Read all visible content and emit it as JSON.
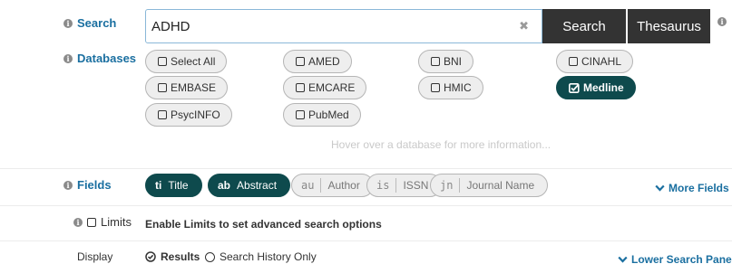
{
  "search": {
    "label": "Search",
    "value": "ADHD",
    "search_button": "Search",
    "thesaurus_button": "Thesaurus"
  },
  "databases": {
    "label": "Databases",
    "items": [
      {
        "label": "Select All",
        "checked": false
      },
      {
        "label": "AMED",
        "checked": false
      },
      {
        "label": "BNI",
        "checked": false
      },
      {
        "label": "CINAHL",
        "checked": false
      },
      {
        "label": "EMBASE",
        "checked": false
      },
      {
        "label": "EMCARE",
        "checked": false
      },
      {
        "label": "HMIC",
        "checked": false
      },
      {
        "label": "Medline",
        "checked": true
      },
      {
        "label": "PsycINFO",
        "checked": false
      },
      {
        "label": "PubMed",
        "checked": false
      }
    ],
    "hint": "Hover over a database for more information..."
  },
  "fields": {
    "label": "Fields",
    "items": [
      {
        "abbr": "ti",
        "label": "Title",
        "active": true
      },
      {
        "abbr": "ab",
        "label": "Abstract",
        "active": true
      },
      {
        "abbr": "au",
        "label": "Author",
        "active": false
      },
      {
        "abbr": "is",
        "label": "ISSN",
        "active": false
      },
      {
        "abbr": "jn",
        "label": "Journal Name",
        "active": false
      }
    ],
    "more_link": "More Fields"
  },
  "limits": {
    "label": "Limits",
    "text": "Enable Limits to set advanced search options"
  },
  "display": {
    "label": "Display",
    "options": [
      "Results",
      "Search History Only"
    ],
    "selected": "Results",
    "lower_link": "Lower Search Panel"
  },
  "colors": {
    "accent_blue": "#1a6fa0",
    "dark_teal": "#0e4a4d",
    "button_dark": "#333333"
  }
}
